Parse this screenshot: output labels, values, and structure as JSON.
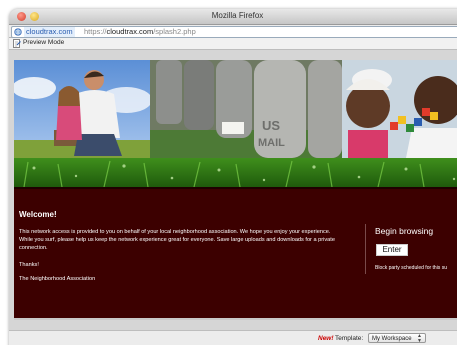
{
  "window": {
    "title": "Mozilla Firefox"
  },
  "urlbar": {
    "domain_badge": "cloudtrax.com",
    "url_prefix": "https://",
    "url_host": "cloudtrax.com",
    "url_path": "/splash2.php",
    "icon": "globe-icon"
  },
  "toolbar": {
    "preview_label": "Preview Mode",
    "icon": "document-icon"
  },
  "splash": {
    "welcome": "Welcome!",
    "body": "This network access is provided to you on behalf of your local neighborhood association. We hope you enjoy your experience. While you surf, please help us keep the network experience great for everyone. Save large uploads and downloads for a private connection.",
    "thanks": "Thanks!",
    "signature": "The Neighborhood Association",
    "begin_browsing": "Begin browsing",
    "enter_label": "Enter",
    "announcement": "Block party scheduled for this su",
    "photos": [
      "family-photo",
      "mailboxes-photo",
      "children-photo"
    ]
  },
  "statusbar": {
    "new_label": "New!",
    "template_label": "Template:",
    "template_value": "My Workspace"
  },
  "colors": {
    "page_background": "#3c0000",
    "new_badge": "#cc0000",
    "link_blue": "#2a5db0"
  }
}
